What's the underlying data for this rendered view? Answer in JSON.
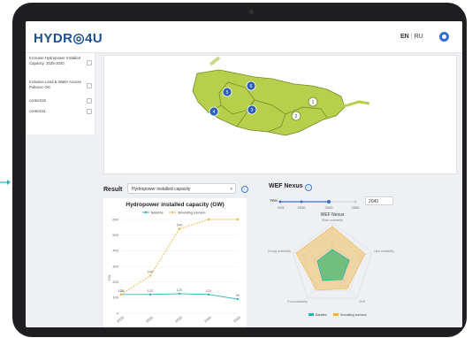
{
  "app": {
    "logo": "HYDR◎4U"
  },
  "header": {
    "lang_active": "EN",
    "lang_other": "RU"
  },
  "sidebar": {
    "items": [
      {
        "label": "Increase Hydropower Installed Capacity: 2025-2040"
      },
      {
        "label": "Inclusive Land & Water Access Policies: ON"
      },
      {
        "label": "content18"
      },
      {
        "label": "content11"
      }
    ]
  },
  "map": {
    "markers": [
      "6",
      "5",
      "4",
      "3",
      "2",
      "1"
    ]
  },
  "result": {
    "label": "Result",
    "selected": "Hydropower installed capacity"
  },
  "chart_data": {
    "type": "line",
    "title": "Hydropower installed capacity (GW)",
    "ylabel": "GW",
    "categories": [
      "2025",
      "2030",
      "2035",
      "2040",
      "2045"
    ],
    "ylim": [
      0,
      600
    ],
    "yticks": [
      "0",
      "100",
      "200",
      "300",
      "400",
      "500",
      "600"
    ],
    "series": [
      {
        "name": "Baseline",
        "values": [
          120,
          120,
          125,
          120,
          90
        ],
        "color": "#2bb3b1",
        "labels": [
          "120",
          "120",
          "120",
          "120",
          "90"
        ]
      },
      {
        "name": "Simulating scenario",
        "values": [
          120,
          240,
          540,
          600,
          600
        ],
        "color": "#f0b43c",
        "labels": [
          "120",
          "240",
          "540",
          "",
          ""
        ]
      }
    ]
  },
  "wef": {
    "title": "WEF Nexus",
    "year_label": "Year",
    "year_ticks": [
      "2025",
      "2030",
      "2040",
      "2050"
    ],
    "year_value": "2040",
    "radar_title": "WEF Nexus",
    "axes": [
      "Water availability",
      "Land availability",
      "GHG",
      "Food availability",
      "Energy availability"
    ],
    "series": [
      {
        "name": "Baseline",
        "color": "#2bb3b1"
      },
      {
        "name": "Simulating scenario",
        "color": "#f0b43c"
      }
    ]
  }
}
